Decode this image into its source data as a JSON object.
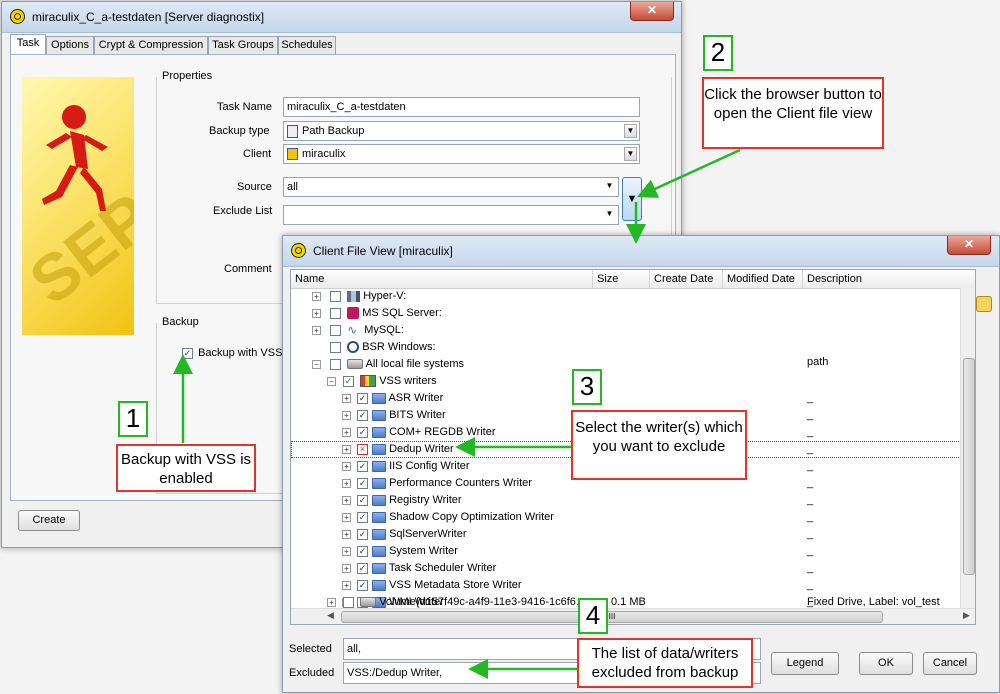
{
  "main_window": {
    "title": "miraculix_C_a-testdaten [Server diagnostix]",
    "tabs": [
      {
        "label": "Task"
      },
      {
        "label": "Options"
      },
      {
        "label": "Crypt & Compression"
      },
      {
        "label": "Task Groups"
      },
      {
        "label": "Schedules"
      }
    ],
    "properties_label": "Properties",
    "task_name_label": "Task Name",
    "task_name_value": "miraculix_C_a-testdaten",
    "backup_type_label": "Backup type",
    "backup_type_value": "Path Backup",
    "client_label": "Client",
    "client_value": "miraculix",
    "source_label": "Source",
    "source_value": "all",
    "exclude_label": "Exclude List",
    "exclude_value": "",
    "comment_label": "Comment",
    "backup_group_label": "Backup",
    "vss_label": "Backup with VSS",
    "create_label": "Create",
    "browse_arrow": "▼"
  },
  "cfv": {
    "title": "Client File View [miraculix]",
    "close": "✕",
    "columns": [
      "Name",
      "Size",
      "Create Date",
      "Modified Date",
      "Description"
    ],
    "rows": [
      {
        "name": "Hyper-V:",
        "desc": ""
      },
      {
        "name": "MS SQL Server:",
        "desc": ""
      },
      {
        "name": "MySQL:",
        "desc": ""
      },
      {
        "name": "BSR Windows:",
        "desc": ""
      },
      {
        "name": "All local file systems",
        "desc": "path"
      },
      {
        "name": "VSS writers",
        "desc": ""
      },
      {
        "name": "ASR Writer",
        "desc": "_"
      },
      {
        "name": "BITS Writer",
        "desc": "_"
      },
      {
        "name": "COM+ REGDB Writer",
        "desc": "_"
      },
      {
        "name": "Dedup Writer",
        "desc": "_"
      },
      {
        "name": "IIS Config Writer",
        "desc": "_"
      },
      {
        "name": "Performance Counters Writer",
        "desc": "_"
      },
      {
        "name": "Registry Writer",
        "desc": "_"
      },
      {
        "name": "Shadow Copy Optimization Writer",
        "desc": "_"
      },
      {
        "name": "SqlServerWriter",
        "desc": "_"
      },
      {
        "name": "System Writer",
        "desc": "_"
      },
      {
        "name": "Task Scheduler Writer",
        "desc": "_"
      },
      {
        "name": "VSS Metadata Store Writer",
        "desc": "_"
      },
      {
        "name": "WMI Writer",
        "desc": "_"
      },
      {
        "name": "Volume{d157f49c-a4f9-11e3-9416-1c6f6...",
        "size": "0.1 MB",
        "desc": "Fixed Drive, Label: vol_test"
      }
    ],
    "selected_label": "Selected",
    "selected_value": "all,",
    "excluded_label": "Excluded",
    "excluded_value": "VSS:/Dedup Writer,",
    "legend_label": "Legend",
    "ok_label": "OK",
    "cancel_label": "Cancel",
    "scroll_mark": "III"
  },
  "annotations": {
    "n1": "1",
    "t1": "Backup with VSS is enabled",
    "n2": "2",
    "t2": "Click the browser button to open the Client file view",
    "n3": "3",
    "t3": "Select the writer(s) which you want to exclude",
    "n4": "4",
    "t4": "The list of data/writers excluded from backup"
  },
  "colors": {
    "accent_red": "#e0342c",
    "accent_green": "#24b824"
  }
}
